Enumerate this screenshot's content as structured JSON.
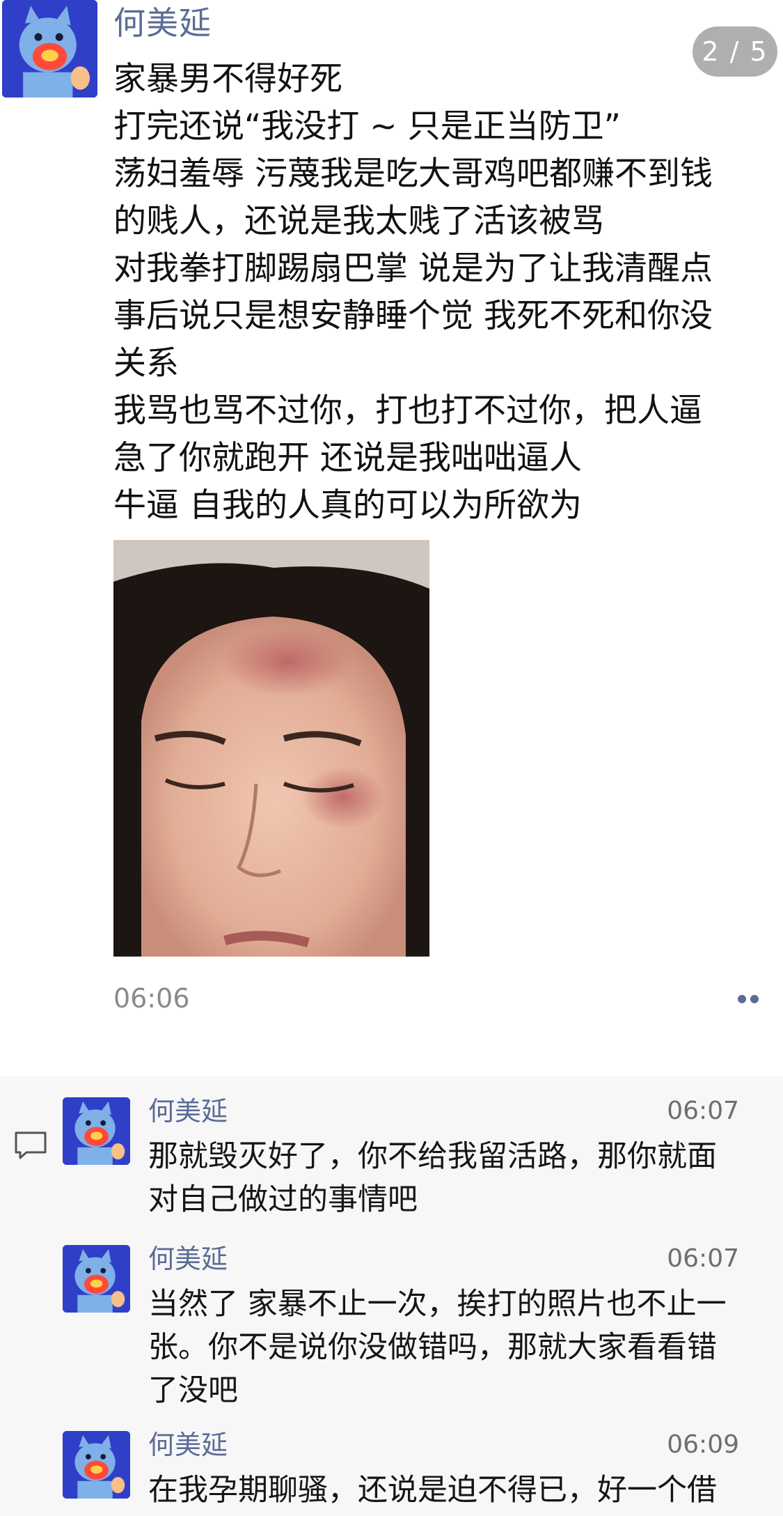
{
  "post": {
    "author": "何美延",
    "page_indicator": "2 / 5",
    "lines": [
      "家暴男不得好死",
      "打完还说“我没打 ~ 只是正当防卫”",
      "荡妇羞辱 污蔑我是吃大哥鸡吧都赚不到钱",
      "的贱人，还说是我太贱了活该被骂",
      "对我拳打脚踢扇巴掌 说是为了让我清醒点",
      "事后说只是想安静睡个觉 我死不死和你没",
      "关系",
      "我骂也骂不过你，打也打不过你，把人逼",
      "急了你就跑开 还说是我咄咄逼人",
      "牛逼 自我的人真的可以为所欲为"
    ],
    "time": "06:06"
  },
  "comments": [
    {
      "author": "何美延",
      "time": "06:07",
      "lines": [
        "那就毁灭好了，你不给我留活路，那你就面",
        "对自己做过的事情吧"
      ]
    },
    {
      "author": "何美延",
      "time": "06:07",
      "lines": [
        "当然了 家暴不止一次，挨打的照片也不止一",
        "张。你不是说你没做错吗，那就大家看看错",
        "了没吧"
      ]
    },
    {
      "author": "何美延",
      "time": "06:09",
      "lines": [
        "在我孕期聊骚，还说是迫不得已，好一个借"
      ]
    }
  ],
  "icons": {
    "avatar": "cartoon-avatar-icon",
    "comment": "comment-bubble-icon",
    "more": "more-dots-icon"
  },
  "colors": {
    "name": "#5b6b95",
    "avatar_bg": "#2e3fc6",
    "comments_bg": "#f7f7f8"
  }
}
